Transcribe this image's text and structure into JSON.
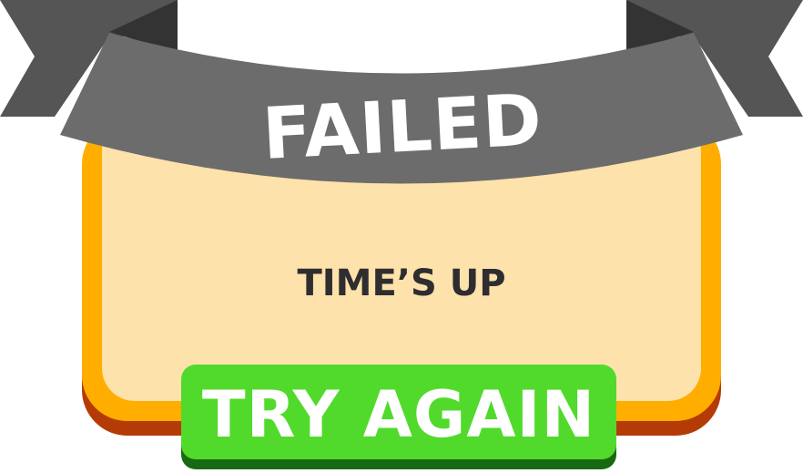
{
  "popup": {
    "title": "FAILED",
    "message": "TIME’S UP",
    "button_label": "TRY AGAIN"
  },
  "colors": {
    "ribbon_main": "#6c6c6c",
    "ribbon_dark": "#3a3a3a",
    "ribbon_fold": "#333333",
    "panel_border": "#ffae00",
    "panel_shadow": "#b53b06",
    "panel_fill": "#fee2ab",
    "message_text": "#2e2d30",
    "button_fill": "#51da2b",
    "button_shadow": "#186a12",
    "title_text": "#ffffff"
  }
}
